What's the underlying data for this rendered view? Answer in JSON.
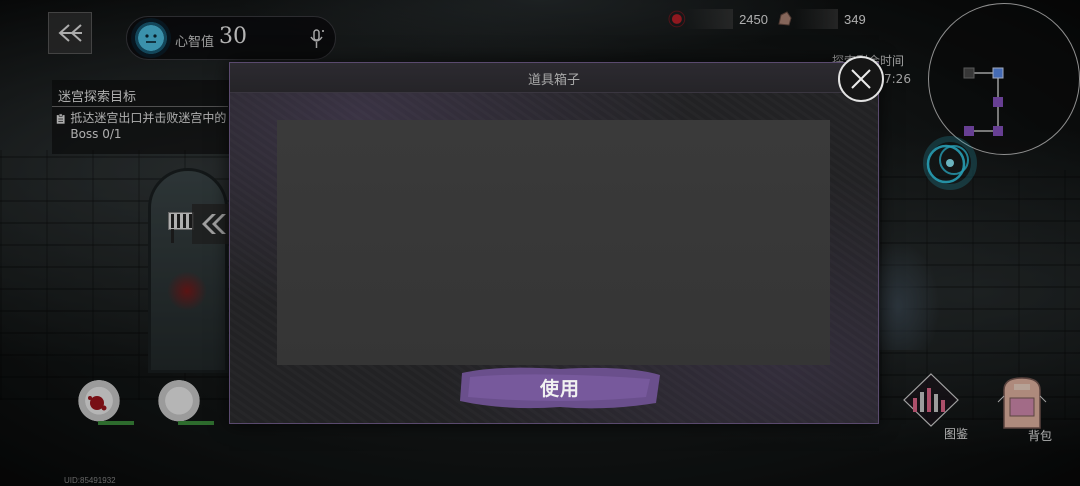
{
  "hud": {
    "sanity": {
      "label": "心智值",
      "value": "30",
      "icon": "face-icon"
    },
    "resources": [
      {
        "icon": "red-orb-icon",
        "value": "2450"
      },
      {
        "icon": "rock-icon",
        "value": "349"
      }
    ],
    "quest": {
      "title": "迷宫探索目标",
      "items": [
        {
          "icon": "clipboard-icon",
          "text": "抵达迷宫出口并击败迷宫中的Boss 0/1"
        }
      ]
    },
    "timer": {
      "label": "探索剩余时间",
      "value": "7:26"
    },
    "uid": "UID:85491932",
    "buttons": {
      "codex": "图鉴",
      "bag": "背包"
    }
  },
  "modal": {
    "title": "道具箱子",
    "use_label": "使用",
    "close_icon": "close-icon"
  },
  "colors": {
    "accent_purple": "#7a5ba0",
    "portal_cyan": "#35d2f0",
    "hp_green": "#3c8f3c",
    "minimap_node": "#8a55c4",
    "minimap_current": "#5d8ff0"
  }
}
